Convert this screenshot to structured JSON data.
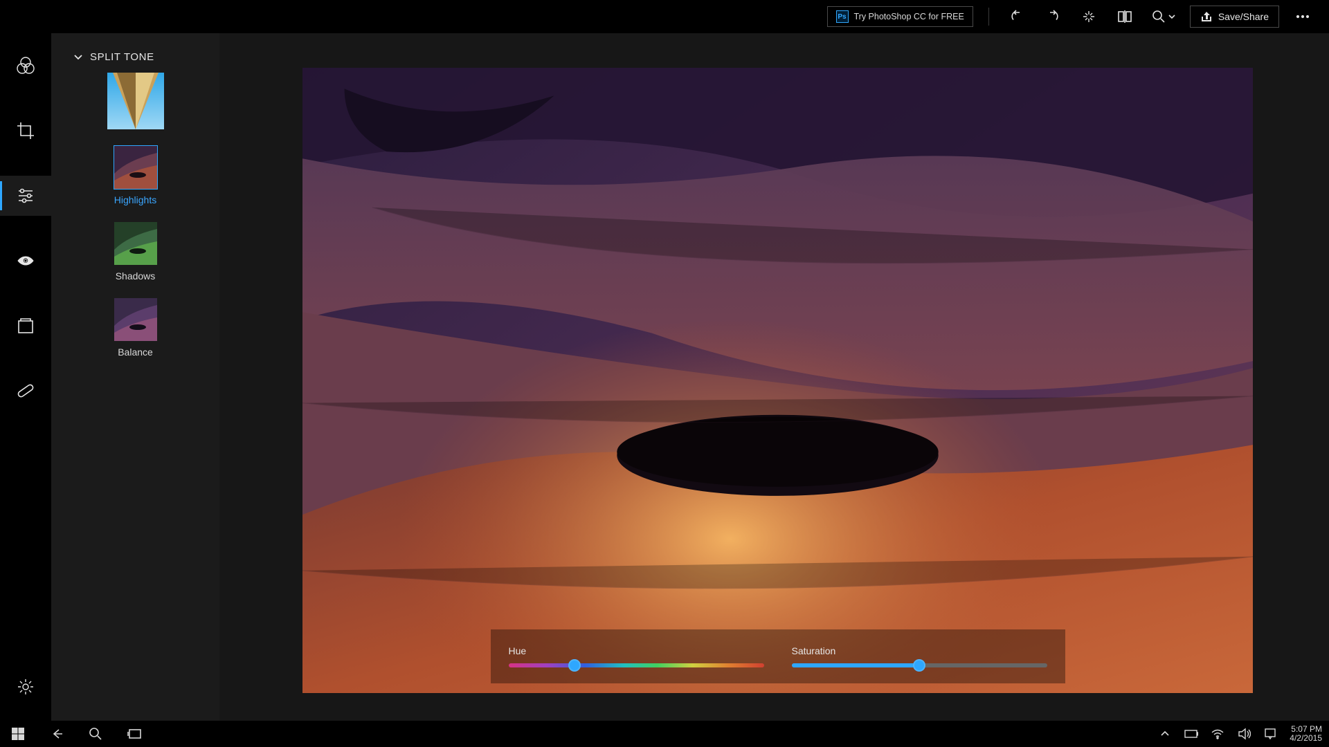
{
  "topbar": {
    "ps_promo": "Try PhotoShop CC for FREE",
    "ps_badge": "Ps",
    "save_share": "Save/Share"
  },
  "panel": {
    "title": "SPLIT TONE",
    "items": [
      {
        "label": "Highlights"
      },
      {
        "label": "Shadows"
      },
      {
        "label": "Balance"
      }
    ]
  },
  "sliders": {
    "hue_label": "Hue",
    "hue_pct": 26,
    "sat_label": "Saturation",
    "sat_pct": 50
  },
  "taskbar": {
    "time": "5:07 PM",
    "date": "4/2/2015"
  }
}
